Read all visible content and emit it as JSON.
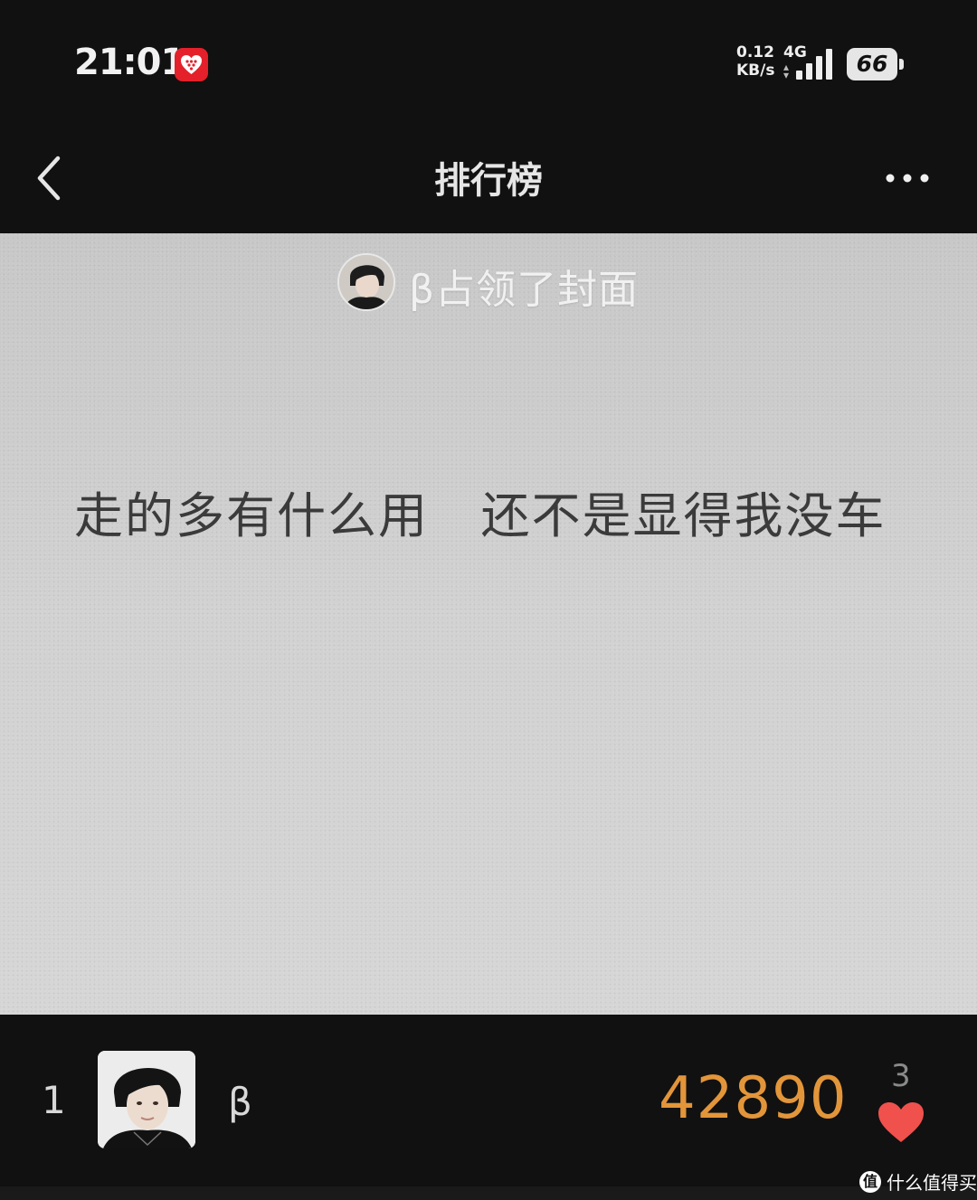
{
  "status_bar": {
    "time": "21:01",
    "net_speed_value": "0.12",
    "net_speed_unit": "KB/s",
    "network_type": "4G",
    "battery_level": "66",
    "app_icon": "heart-app-icon"
  },
  "nav": {
    "title": "排行榜",
    "back_icon": "back-chevron-icon",
    "more_icon": "more-dots-icon"
  },
  "cover": {
    "occupied_text": "β占领了封面",
    "quote": "走的多有什么用   还不是显得我没车"
  },
  "ranking": [
    {
      "rank": "1",
      "name": "β",
      "score": "42890",
      "likes": "3",
      "score_color": "#e3953a",
      "heart_color": "#f0514d"
    }
  ],
  "watermark": {
    "badge": "值",
    "text": "什么值得买"
  }
}
